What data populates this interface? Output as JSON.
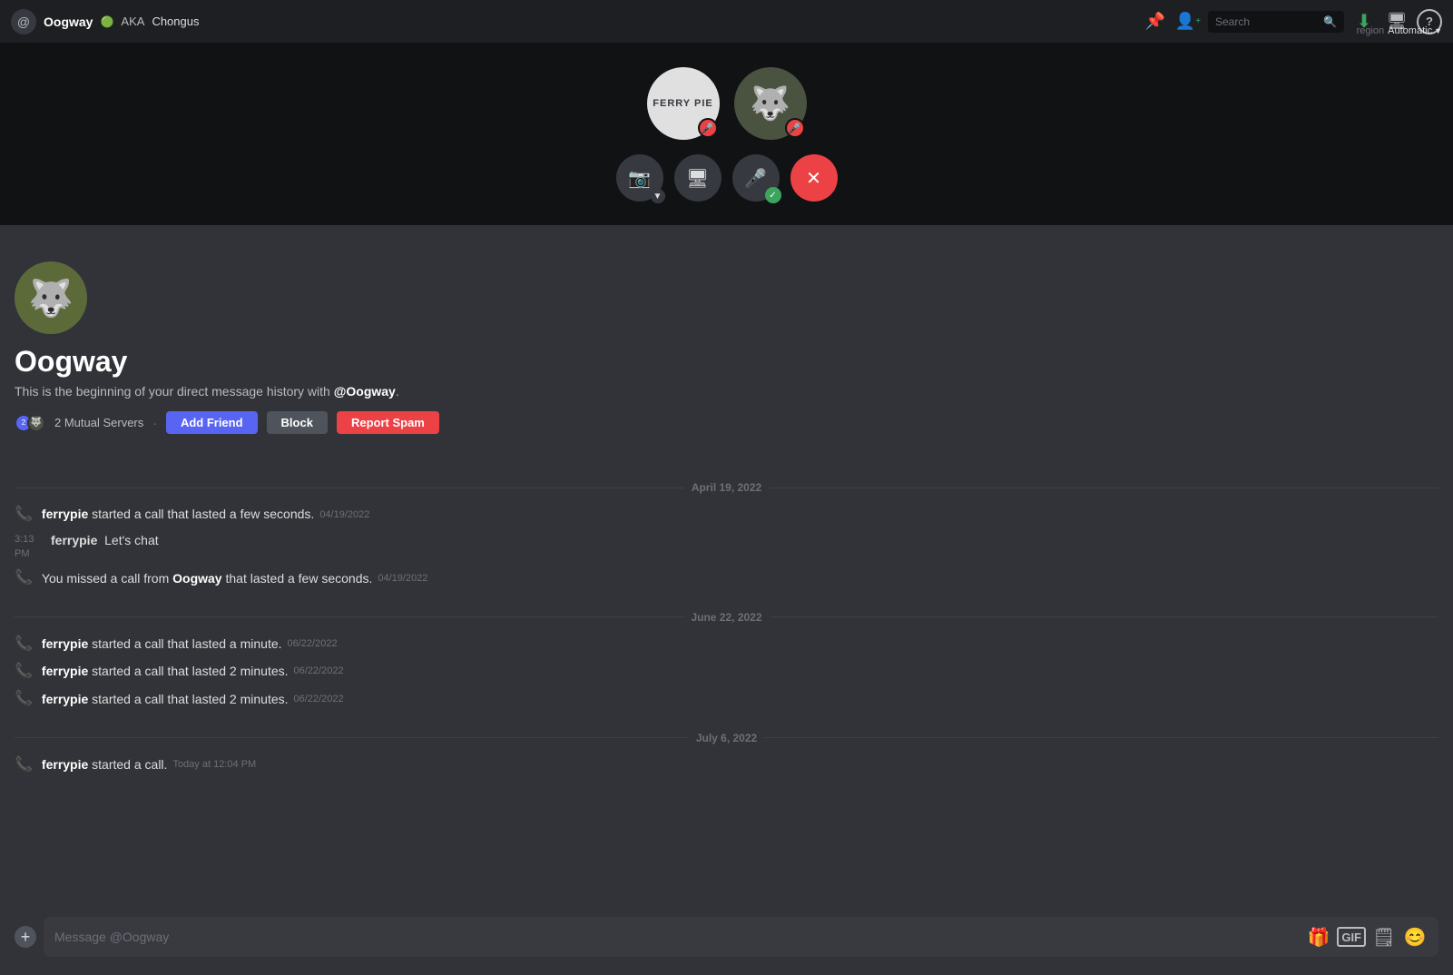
{
  "topbar": {
    "at_icon": "@",
    "username": "Oogway",
    "online_indicator": "🟢",
    "aka_label": "AKA",
    "nickname": "Chongus",
    "icons": {
      "pin": "📌",
      "add_friend": "👤",
      "search_placeholder": "Search",
      "download": "⬇",
      "screen": "🖥",
      "help": "?"
    },
    "region_label": "region",
    "region_value": "Automatic"
  },
  "call": {
    "participant1": {
      "name": "FERRY PIE",
      "muted": true
    },
    "participant2": {
      "name": "Oogway",
      "muted": true
    },
    "controls": {
      "camera": "📷",
      "screen_share": "🖥",
      "mute": "🎤",
      "end_call": "✕"
    }
  },
  "profile": {
    "name": "Oogway",
    "description_pre": "This is the beginning of your direct message history with ",
    "description_handle": "@Oogway",
    "description_post": ".",
    "mutual_servers_count": "2 Mutual Servers",
    "buttons": {
      "add_friend": "Add Friend",
      "block": "Block",
      "report_spam": "Report Spam"
    }
  },
  "chat": {
    "date_separators": [
      "April 19, 2022",
      "June 22, 2022",
      "July 6, 2022"
    ],
    "messages": [
      {
        "type": "call",
        "icon": "phone",
        "author": "ferrypie",
        "text": "started a call that lasted a few seconds.",
        "timestamp": "04/19/2022",
        "missed": false
      },
      {
        "type": "chat",
        "time": "3:13 PM",
        "author": "ferrypie",
        "content": "Let's chat"
      },
      {
        "type": "missed_call",
        "icon": "phone",
        "text_pre": "You missed a call from ",
        "caller": "Oogway",
        "text_post": " that lasted a few seconds.",
        "timestamp": "04/19/2022",
        "missed": true
      },
      {
        "type": "call",
        "icon": "phone",
        "author": "ferrypie",
        "text": "started a call that lasted a minute.",
        "timestamp": "06/22/2022",
        "missed": false,
        "date_sep": "June 22, 2022"
      },
      {
        "type": "call",
        "icon": "phone",
        "author": "ferrypie",
        "text": "started a call that lasted 2 minutes.",
        "timestamp": "06/22/2022",
        "missed": false
      },
      {
        "type": "call",
        "icon": "phone",
        "author": "ferrypie",
        "text": "started a call that lasted 2 minutes.",
        "timestamp": "06/22/2022",
        "missed": false
      },
      {
        "type": "call",
        "icon": "phone",
        "author": "ferrypie",
        "text": "started a call.",
        "timestamp": "Today at 12:04 PM",
        "missed": false,
        "date_sep": "July 6, 2022"
      }
    ],
    "input_placeholder": "Message @Oogway"
  }
}
